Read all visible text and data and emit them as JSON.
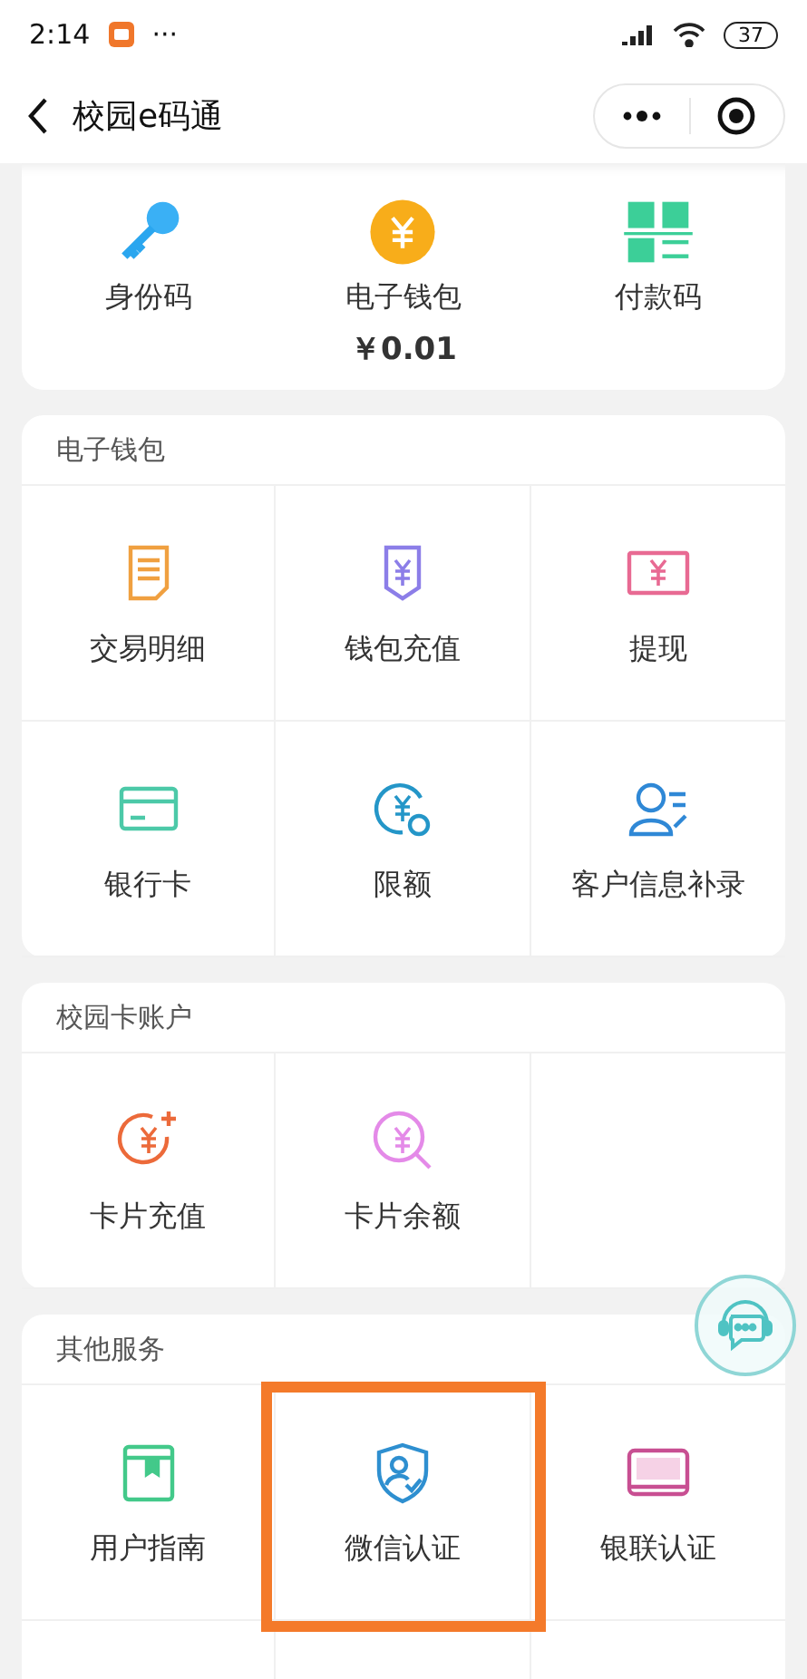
{
  "status_bar": {
    "time": "2:14",
    "more": "···",
    "battery": "37"
  },
  "nav": {
    "title": "校园e码通"
  },
  "quick": [
    {
      "label": "身份码"
    },
    {
      "label": "电子钱包",
      "amount": "￥0.01"
    },
    {
      "label": "付款码"
    }
  ],
  "sections": [
    {
      "title": "电子钱包",
      "items": [
        {
          "label": "交易明细",
          "highlighted": false
        },
        {
          "label": "钱包充值",
          "highlighted": false
        },
        {
          "label": "提现",
          "highlighted": false
        },
        {
          "label": "银行卡",
          "highlighted": false
        },
        {
          "label": "限额",
          "highlighted": false
        },
        {
          "label": "客户信息补录",
          "highlighted": false
        }
      ]
    },
    {
      "title": "校园卡账户",
      "items": [
        {
          "label": "卡片充值",
          "highlighted": false
        },
        {
          "label": "卡片余额",
          "highlighted": false
        }
      ]
    },
    {
      "title": "其他服务",
      "items": [
        {
          "label": "用户指南",
          "highlighted": false
        },
        {
          "label": "微信认证",
          "highlighted": true
        },
        {
          "label": "银联认证",
          "highlighted": false
        }
      ],
      "more_rows": true
    }
  ]
}
